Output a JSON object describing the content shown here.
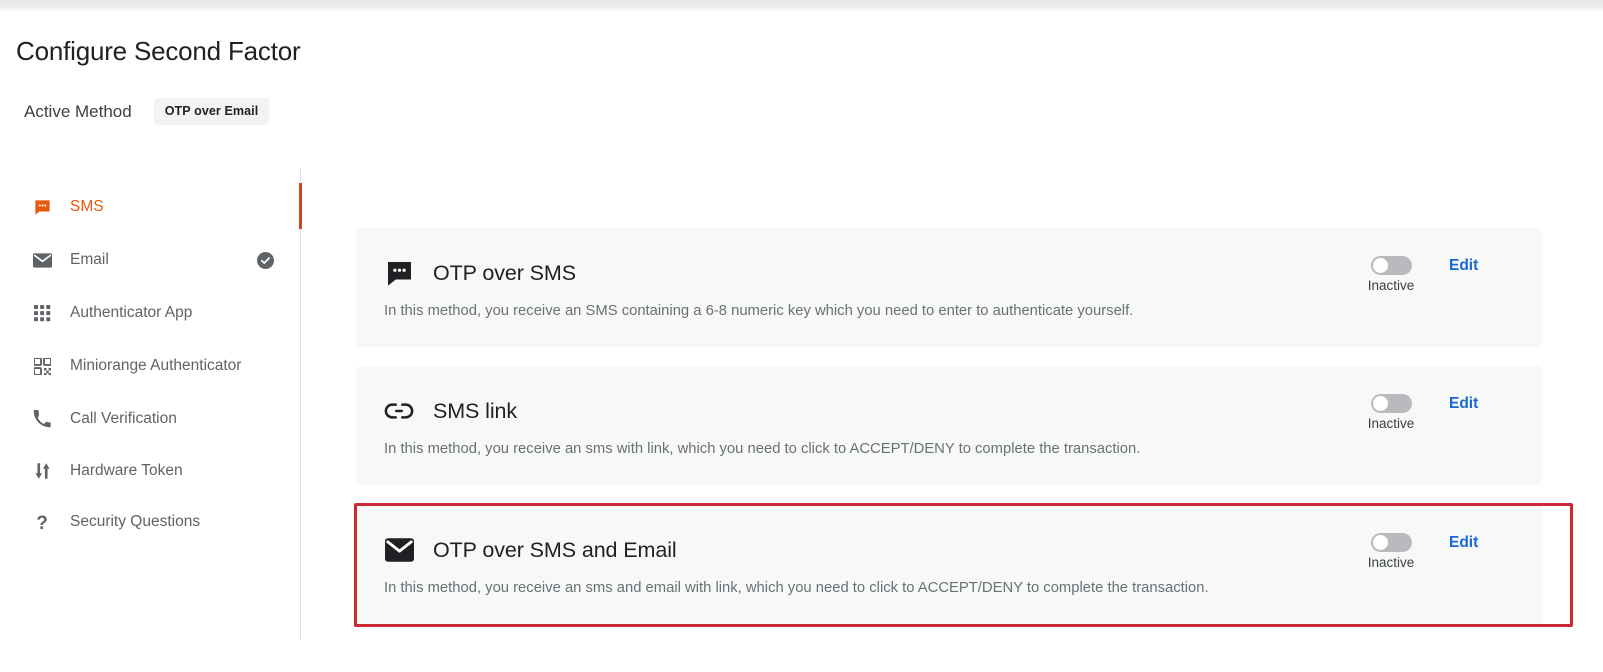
{
  "header": {
    "title": "Configure Second Factor",
    "active_method_label": "Active Method",
    "active_method_value": "OTP over Email"
  },
  "sidebar": {
    "items": [
      {
        "label": "SMS",
        "icon": "sms-icon",
        "active": true,
        "verified": false
      },
      {
        "label": "Email",
        "icon": "email-icon",
        "active": false,
        "verified": true
      },
      {
        "label": "Authenticator App",
        "icon": "apps-grid-icon",
        "active": false,
        "verified": false
      },
      {
        "label": "Miniorange Authenticator",
        "icon": "qr-code-icon",
        "active": false,
        "verified": false
      },
      {
        "label": "Call Verification",
        "icon": "phone-icon",
        "active": false,
        "verified": false
      },
      {
        "label": "Hardware Token",
        "icon": "hardware-token-icon",
        "active": false,
        "verified": false
      },
      {
        "label": "Security Questions",
        "icon": "question-mark-icon",
        "active": false,
        "verified": false
      }
    ]
  },
  "methods": [
    {
      "title": "OTP over SMS",
      "icon": "chat-bubble-icon",
      "description": "In this method, you receive an SMS containing a 6-8 numeric key which you need to enter to authenticate yourself.",
      "toggle_state": "Inactive",
      "toggle_on": false,
      "edit_label": "Edit",
      "highlighted": false
    },
    {
      "title": "SMS link",
      "icon": "link-icon",
      "description": "In this method, you receive an sms with link, which you need to click to ACCEPT/DENY to complete the transaction.",
      "toggle_state": "Inactive",
      "toggle_on": false,
      "edit_label": "Edit",
      "highlighted": false
    },
    {
      "title": "OTP over SMS and Email",
      "icon": "envelope-icon",
      "description": "In this method, you receive an sms and email with link, which you need to click to ACCEPT/DENY to complete the transaction.",
      "toggle_state": "Inactive",
      "toggle_on": false,
      "edit_label": "Edit",
      "highlighted": true
    }
  ],
  "colors": {
    "accent_orange": "#e8590c",
    "link_blue": "#1967d2",
    "highlight_red": "#cc2936",
    "card_bg": "#f7f8f8"
  }
}
